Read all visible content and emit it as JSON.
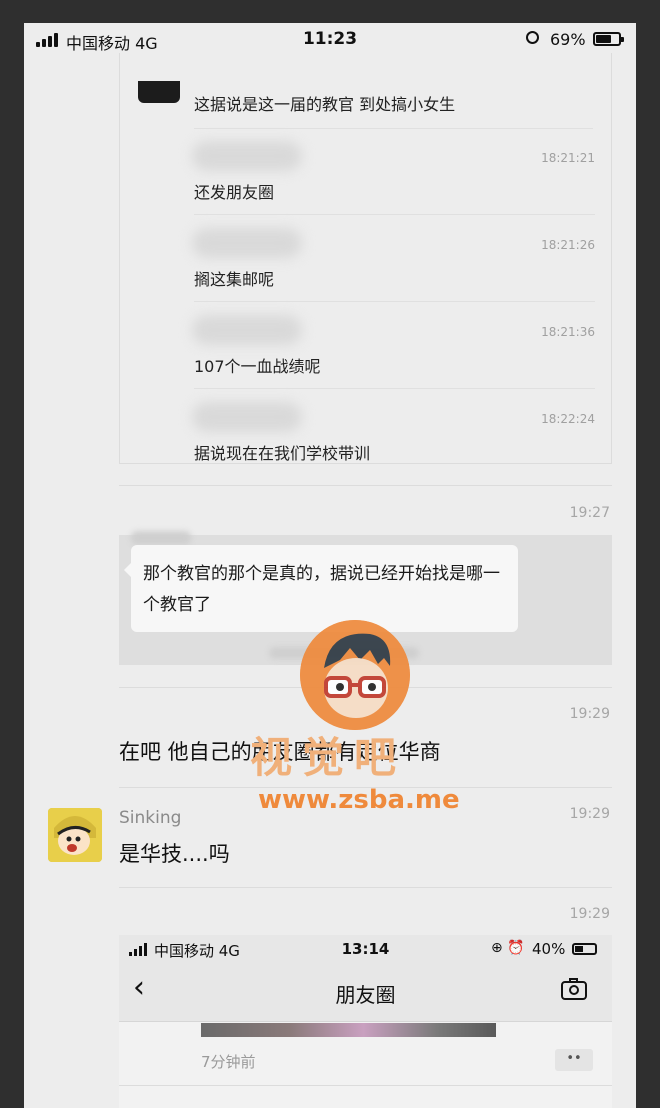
{
  "status_bar": {
    "carrier": "中国移动  4G",
    "time": "11:23",
    "battery": "69%",
    "battery_level": 0.69
  },
  "record": {
    "first_text": "这据说是这一届的教官 到处搞小女生",
    "entries": [
      {
        "time": "18:21:21",
        "text": "还发朋友圈"
      },
      {
        "time": "18:21:26",
        "text": "搁这集邮呢"
      },
      {
        "time": "18:21:36",
        "text": "107个一血战绩呢"
      },
      {
        "time": "18:22:24",
        "text": "据说现在在我们学校带训"
      }
    ]
  },
  "messages": [
    {
      "time": "19:27",
      "quote": "那个教官的那个是真的，据说已经开始找是哪一个教官了"
    },
    {
      "time": "19:29",
      "text": "在吧 他自己的朋友圈都有定位华商"
    },
    {
      "time": "19:29",
      "sender": "Sinking",
      "text": "是华技....吗"
    },
    {
      "time": "19:29"
    }
  ],
  "embedded_screenshot": {
    "carrier": "中国移动  4G",
    "time": "13:14",
    "status_icons": "⊕ ⏰",
    "battery": "40%",
    "battery_level": 0.4,
    "title": "朋友圈",
    "back": "‹",
    "post_time": "7分钟前",
    "more": "••"
  },
  "watermark": {
    "title": "视觉吧",
    "url": "www.zsba.me"
  },
  "colors": {
    "background": "#ededed",
    "watermark": "#ef8a3c"
  }
}
